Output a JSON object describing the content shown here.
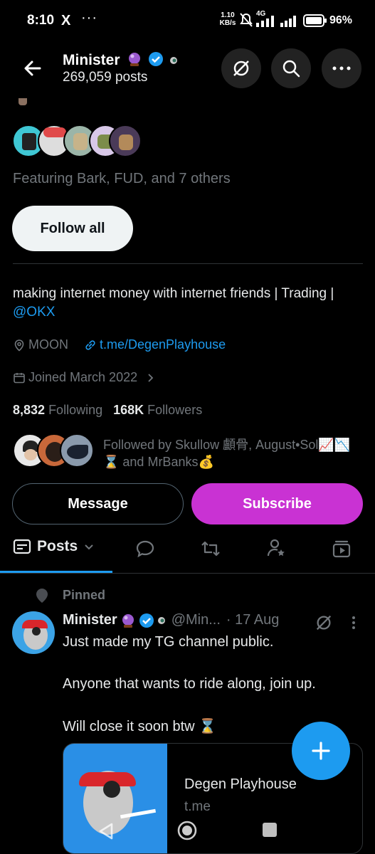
{
  "status_bar": {
    "time": "8:10",
    "x_icon": "X",
    "dots": "···",
    "speed_value": "1.10",
    "speed_unit": "KB/s",
    "network": "4G",
    "battery": "96%"
  },
  "header": {
    "name": "Minister",
    "posts": "269,059 posts"
  },
  "featuring": "Featuring Bark, FUD, and 7 others",
  "follow_all_label": "Follow all",
  "bio": {
    "text": "making internet money with internet friends | Trading | ",
    "link": "@OKX"
  },
  "location": "MOON",
  "website": "t.me/DegenPlayhouse",
  "joined": "Joined March 2022",
  "stats": {
    "following_count": "8,832",
    "following_label": "Following",
    "followers_count": "168K",
    "followers_label": "Followers"
  },
  "followed_by": "Followed by Skullow 顱骨, August•Sol📈📉⌛ and MrBanks💰",
  "buttons": {
    "message": "Message",
    "subscribe": "Subscribe"
  },
  "tabs": {
    "posts": "Posts"
  },
  "pinned_label": "Pinned",
  "post": {
    "name": "Minister",
    "handle": "@Min...",
    "date": "· 17 Aug",
    "line1": "Just made my TG channel public.",
    "line2": "Anyone that wants to ride along, join up.",
    "line3": "Will close it soon btw ⌛",
    "card_title": "Degen Playhouse",
    "card_domain": "t.me"
  },
  "colors": {
    "accent": "#1d9bf0",
    "subscribe": "#c932d3",
    "muted": "#71767b",
    "background": "#000000"
  },
  "icons": [
    "back-arrow-icon",
    "grok-icon",
    "search-icon",
    "more-icon",
    "location-icon",
    "link-icon",
    "calendar-icon",
    "chevron-right-icon",
    "posts-icon",
    "replies-icon",
    "retweet-icon",
    "highlights-icon",
    "media-icon",
    "pin-icon",
    "verified-icon",
    "plus-icon"
  ]
}
